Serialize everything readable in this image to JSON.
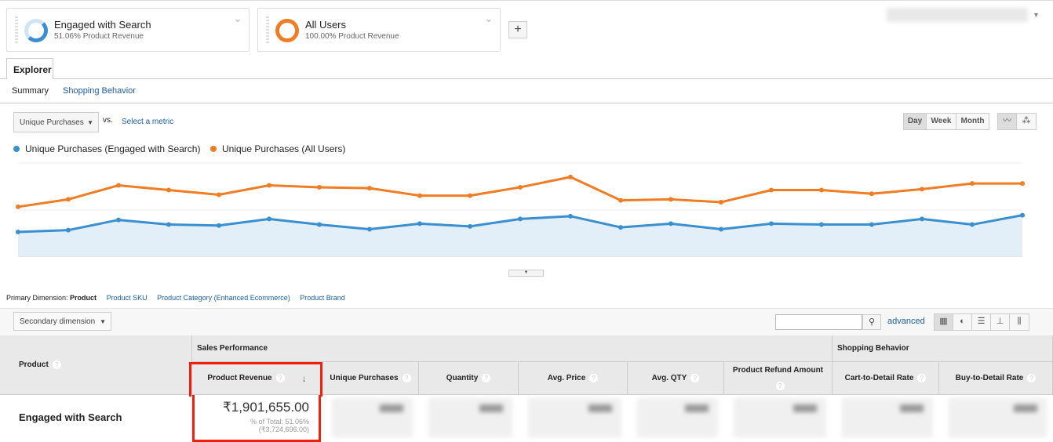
{
  "segments": [
    {
      "name": "Engaged with Search",
      "subtitle": "51.06% Product Revenue",
      "color": "#3a8fd0"
    },
    {
      "name": "All Users",
      "subtitle": "100.00% Product Revenue",
      "color": "#f07c23"
    }
  ],
  "add_segment": "+",
  "tabs": {
    "explorer": "Explorer"
  },
  "subtabs": {
    "summary": "Summary",
    "shopping": "Shopping Behavior"
  },
  "metric": {
    "selected": "Unique Purchases",
    "vs": "vs.",
    "select": "Select a metric"
  },
  "granularity": [
    "Day",
    "Week",
    "Month"
  ],
  "legend": [
    "Unique Purchases (Engaged with Search)",
    "Unique Purchases (All Users)"
  ],
  "chart_data": {
    "type": "line",
    "series": [
      {
        "name": "Unique Purchases (Engaged with Search)",
        "color": "#3a8fd0",
        "values": [
          26,
          28,
          39,
          34,
          33,
          40,
          34,
          29,
          35,
          32,
          40,
          43,
          31,
          35,
          29,
          35,
          34,
          34,
          40,
          34,
          44
        ]
      },
      {
        "name": "Unique Purchases (All Users)",
        "color": "#f07c23",
        "values": [
          53,
          61,
          76,
          71,
          66,
          76,
          74,
          73,
          65,
          65,
          74,
          85,
          60,
          61,
          58,
          71,
          71,
          67,
          72,
          78,
          78
        ]
      }
    ],
    "ylim": [
      0,
      100
    ],
    "grid": true
  },
  "dimension": {
    "label": "Primary Dimension:",
    "active": "Product",
    "links": [
      "Product SKU",
      "Product Category (Enhanced Ecommerce)",
      "Product Brand"
    ]
  },
  "secondary": "Secondary dimension",
  "advanced": "advanced",
  "table": {
    "product_header": "Product",
    "group1": "Sales Performance",
    "group2": "Shopping Behavior",
    "columns": [
      "Product Revenue",
      "Unique Purchases",
      "Quantity",
      "Avg. Price",
      "Avg. QTY",
      "Product Refund Amount",
      "Cart-to-Detail Rate",
      "Buy-to-Detail Rate"
    ],
    "row": {
      "label": "Engaged with Search",
      "revenue": "₹1,901,655.00",
      "pct": "% of Total: 51.06%",
      "total": "(₹3,724,696.00)"
    }
  }
}
